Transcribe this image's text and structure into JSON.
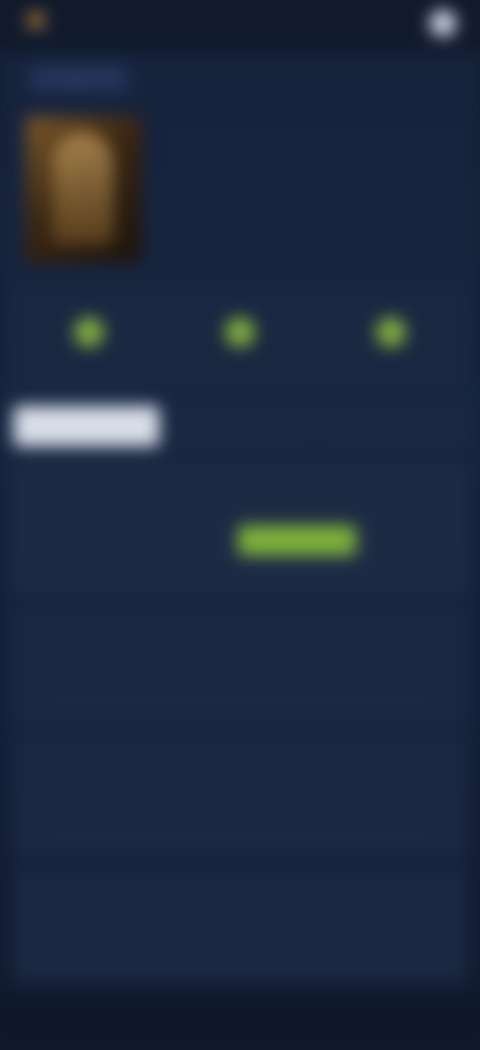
{
  "header": {
    "logo_text": "",
    "actions": [
      "",
      ""
    ],
    "avatar_icon": "user-avatar"
  },
  "breadcrumb": {
    "back_label": "",
    "current": ""
  },
  "hero": {
    "title": "",
    "meta": "",
    "poster_icon": "movie-poster"
  },
  "stats": [
    {
      "label": "",
      "icon": "check-icon"
    },
    {
      "label": "",
      "icon": "check-icon"
    },
    {
      "label": "",
      "icon": "check-icon"
    }
  ],
  "tabs": [
    {
      "label": "",
      "active": true
    },
    {
      "label": "",
      "active": false
    },
    {
      "label": "",
      "active": false
    }
  ],
  "card": {
    "line1": "",
    "line2": "",
    "cta_label": ""
  },
  "sections": [
    {
      "head": "",
      "sub": ""
    },
    {
      "head": "",
      "sub": ""
    },
    {
      "head": "",
      "sub": ""
    }
  ],
  "colors": {
    "accent": "#7eb03c",
    "background": "#121b2e",
    "panel": "#1b2842"
  }
}
